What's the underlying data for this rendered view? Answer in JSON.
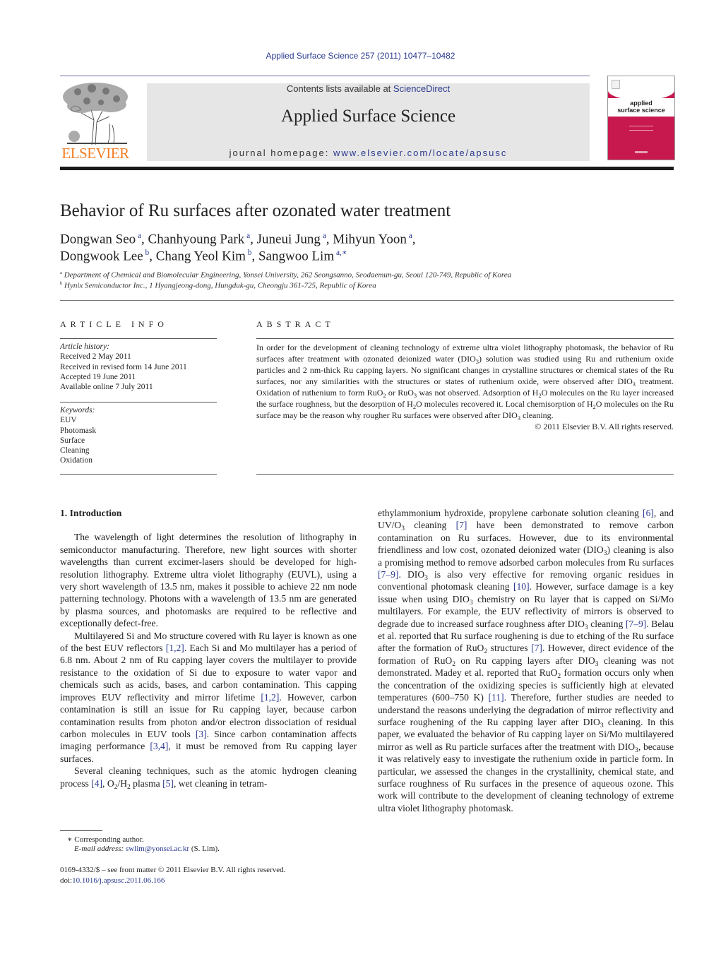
{
  "header": {
    "journal_ref": "Applied Surface Science 257 (2011) 10477–10482",
    "contents_prefix": "Contents lists available at ",
    "contents_link": "ScienceDirect",
    "journal_title": "Applied Surface Science",
    "homepage_prefix": "journal homepage: ",
    "homepage_url": "www.elsevier.com/locate/apsusc",
    "publisher_logo_text": "ELSEVIER",
    "cover_title_line1": "applied",
    "cover_title_line2": "surface science",
    "colors": {
      "link": "#2b3a8f",
      "elsevier_orange": "#f07e26",
      "cover_magenta": "#c8194e",
      "masthead_gray": "#e6e6e6"
    }
  },
  "article": {
    "title": "Behavior of Ru surfaces after ozonated water treatment",
    "authors_line1": [
      {
        "name": "Dongwan Seo",
        "aff": "a"
      },
      {
        "name": "Chanhyoung Park",
        "aff": "a"
      },
      {
        "name": "Juneui Jung",
        "aff": "a"
      },
      {
        "name": "Mihyun Yoon",
        "aff": "a"
      }
    ],
    "authors_line2": [
      {
        "name": "Dongwook Lee",
        "aff": "b"
      },
      {
        "name": "Chang Yeol Kim",
        "aff": "b"
      },
      {
        "name": "Sangwoo Lim",
        "aff": "a,∗"
      }
    ],
    "affiliations": [
      {
        "mark": "a",
        "text": "Department of Chemical and Biomolecular Engineering, Yonsei University, 262 Seongsanno, Seodaemun-gu, Seoul 120-749, Republic of Korea"
      },
      {
        "mark": "b",
        "text": "Hynix Semiconductor Inc., 1 Hyangjeong-dong, Hungduk-gu, Cheongju 361-725, Republic of Korea"
      }
    ]
  },
  "article_info": {
    "heading": "ARTICLE INFO",
    "history_label": "Article history:",
    "history": [
      "Received 2 May 2011",
      "Received in revised form 14 June 2011",
      "Accepted 19 June 2011",
      "Available online 7 July 2011"
    ],
    "keywords_label": "Keywords:",
    "keywords": [
      "EUV",
      "Photomask",
      "Surface",
      "Cleaning",
      "Oxidation"
    ]
  },
  "abstract": {
    "heading": "ABSTRACT",
    "segments": [
      {
        "t": "In order for the development of cleaning technology of extreme ultra violet lithography photomask, the behavior of Ru surfaces after treatment with ozonated deionized water (DIO"
      },
      {
        "sub": "3"
      },
      {
        "t": ") solution was studied using Ru and ruthenium oxide particles and 2 nm-thick Ru capping layers. No significant changes in crystalline structures or chemical states of the Ru surfaces, nor any similarities with the structures or states of ruthenium oxide, were observed after DIO"
      },
      {
        "sub": "3"
      },
      {
        "t": " treatment. Oxidation of ruthenium to form RuO"
      },
      {
        "sub": "2"
      },
      {
        "t": " or RuO"
      },
      {
        "sub": "3"
      },
      {
        "t": " was not observed. Adsorption of H"
      },
      {
        "sub": "2"
      },
      {
        "t": "O molecules on the Ru layer increased the surface roughness, but the desorption of H"
      },
      {
        "sub": "2"
      },
      {
        "t": "O molecules recovered it. Local chemisorption of H"
      },
      {
        "sub": "2"
      },
      {
        "t": "O molecules on the Ru surface may be the reason why rougher Ru surfaces were observed after DIO"
      },
      {
        "sub": "3"
      },
      {
        "t": " cleaning."
      }
    ],
    "copyright": "© 2011 Elsevier B.V. All rights reserved."
  },
  "body": {
    "section_heading": "1.  Introduction",
    "left_paragraphs": [
      [
        {
          "t": "The wavelength of light determines the resolution of lithography in semiconductor manufacturing. Therefore, new light sources with shorter wavelengths than current excimer-lasers should be developed for high-resolution lithography. Extreme ultra violet lithography (EUVL), using a very short wavelength of 13.5 nm, makes it possible to achieve 22 nm node patterning technology. Photons with a wavelength of 13.5 nm are generated by plasma sources, and photomasks are required to be reflective and exceptionally defect-free."
        }
      ],
      [
        {
          "t": "Multilayered Si and Mo structure covered with Ru layer is known as one of the best EUV reflectors "
        },
        {
          "ref": "[1,2]"
        },
        {
          "t": ". Each Si and Mo multilayer has a period of 6.8 nm. About 2 nm of Ru capping layer covers the multilayer to provide resistance to the oxidation of Si due to exposure to water vapor and chemicals such as acids, bases, and carbon contamination. This capping improves EUV reflectivity and mirror lifetime "
        },
        {
          "ref": "[1,2]"
        },
        {
          "t": ". However, carbon contamination is still an issue for Ru capping layer, because carbon contamination results from photon and/or electron dissociation of residual carbon molecules in EUV tools "
        },
        {
          "ref": "[3]"
        },
        {
          "t": ". Since carbon contamination affects imaging performance "
        },
        {
          "ref": "[3,4]"
        },
        {
          "t": ", it must be removed from Ru capping layer surfaces."
        }
      ],
      [
        {
          "t": "Several cleaning techniques, such as the atomic hydrogen cleaning process "
        },
        {
          "ref": "[4]"
        },
        {
          "t": ", O"
        },
        {
          "sub": "2"
        },
        {
          "t": "/H"
        },
        {
          "sub": "2"
        },
        {
          "t": " plasma "
        },
        {
          "ref": "[5]"
        },
        {
          "t": ", wet cleaning in tetram-"
        }
      ]
    ],
    "right_paragraphs": [
      [
        {
          "t": "ethylammonium hydroxide, propylene carbonate solution cleaning "
        },
        {
          "ref": "[6]"
        },
        {
          "t": ", and UV/O"
        },
        {
          "sub": "3"
        },
        {
          "t": " cleaning "
        },
        {
          "ref": "[7]"
        },
        {
          "t": " have been demonstrated to remove carbon contamination on Ru surfaces. However, due to its environmental friendliness and low cost, ozonated deionized water (DIO"
        },
        {
          "sub": "3"
        },
        {
          "t": ") cleaning is also a promising method to remove adsorbed carbon molecules from Ru surfaces "
        },
        {
          "ref": "[7–9]"
        },
        {
          "t": ". DIO"
        },
        {
          "sub": "3"
        },
        {
          "t": " is also very effective for removing organic residues in conventional photomask cleaning "
        },
        {
          "ref": "[10]"
        },
        {
          "t": ". However, surface damage is a key issue when using DIO"
        },
        {
          "sub": "3"
        },
        {
          "t": " chemistry on Ru layer that is capped on Si/Mo multilayers. For example, the EUV reflectivity of mirrors is observed to degrade due to increased surface roughness after DIO"
        },
        {
          "sub": "3"
        },
        {
          "t": " cleaning "
        },
        {
          "ref": "[7–9]"
        },
        {
          "t": ". Belau et al. reported that Ru surface roughening is due to etching of the Ru surface after the formation of RuO"
        },
        {
          "sub": "2"
        },
        {
          "t": " structures "
        },
        {
          "ref": "[7]"
        },
        {
          "t": ". However, direct evidence of the formation of RuO"
        },
        {
          "sub": "2"
        },
        {
          "t": " on Ru capping layers after DIO"
        },
        {
          "sub": "3"
        },
        {
          "t": " cleaning was not demonstrated. Madey et al. reported that RuO"
        },
        {
          "sub": "2"
        },
        {
          "t": " formation occurs only when the concentration of the oxidizing species is sufficiently high at elevated temperatures (600–750 K) "
        },
        {
          "ref": "[11]"
        },
        {
          "t": ". Therefore, further studies are needed to understand the reasons underlying the degradation of mirror reflectivity and surface roughening of the Ru capping layer after DIO"
        },
        {
          "sub": "3"
        },
        {
          "t": " cleaning. In this paper, we evaluated the behavior of Ru capping layer on Si/Mo multilayered mirror as well as Ru particle surfaces after the treatment with DIO"
        },
        {
          "sub": "3"
        },
        {
          "t": ", because it was relatively easy to investigate the ruthenium oxide in particle form. In particular, we assessed the changes in the crystallinity, chemical state, and surface roughness of Ru surfaces in the presence of aqueous ozone. This work will contribute to the development of cleaning technology of extreme ultra violet lithography photomask."
        }
      ]
    ]
  },
  "footnotes": {
    "corresponding_mark": "∗",
    "corresponding_text": " Corresponding author.",
    "email_label": "E-mail address: ",
    "email": "swlim@yonsei.ac.kr",
    "email_suffix": " (S. Lim).",
    "front_matter": "0169-4332/$ – see front matter © 2011 Elsevier B.V. All rights reserved.",
    "doi_prefix": "doi:",
    "doi": "10.1016/j.apsusc.2011.06.166"
  }
}
